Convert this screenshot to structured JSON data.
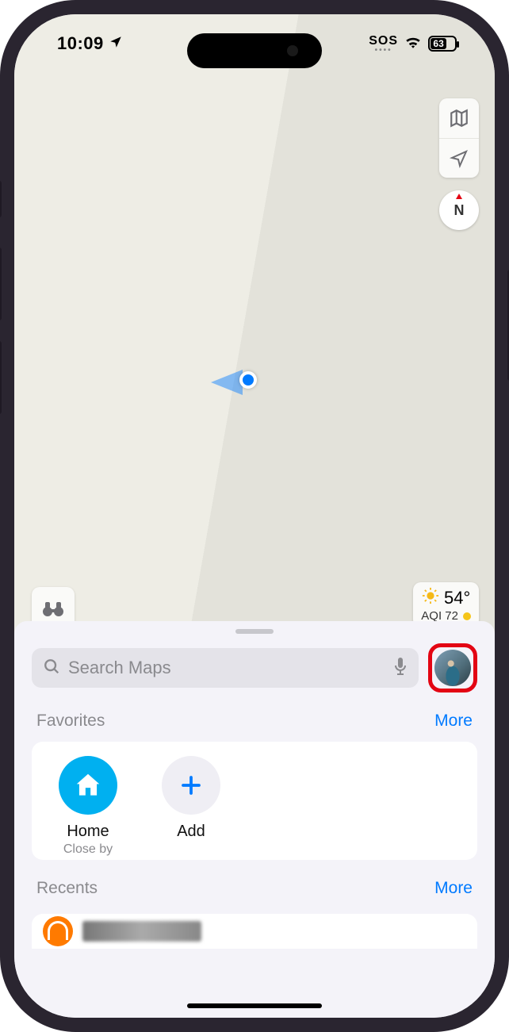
{
  "status": {
    "time": "10:09",
    "sos": "SOS",
    "battery_pct": "63"
  },
  "compass_label": "N",
  "weather": {
    "temp": "54°",
    "aqi": "AQI 72"
  },
  "search_placeholder": "Search Maps",
  "favorites": {
    "title": "Favorites",
    "more": "More",
    "items": [
      {
        "label": "Home",
        "sub": "Close by"
      },
      {
        "label": "Add",
        "sub": ""
      }
    ]
  },
  "recents": {
    "title": "Recents",
    "more": "More"
  }
}
